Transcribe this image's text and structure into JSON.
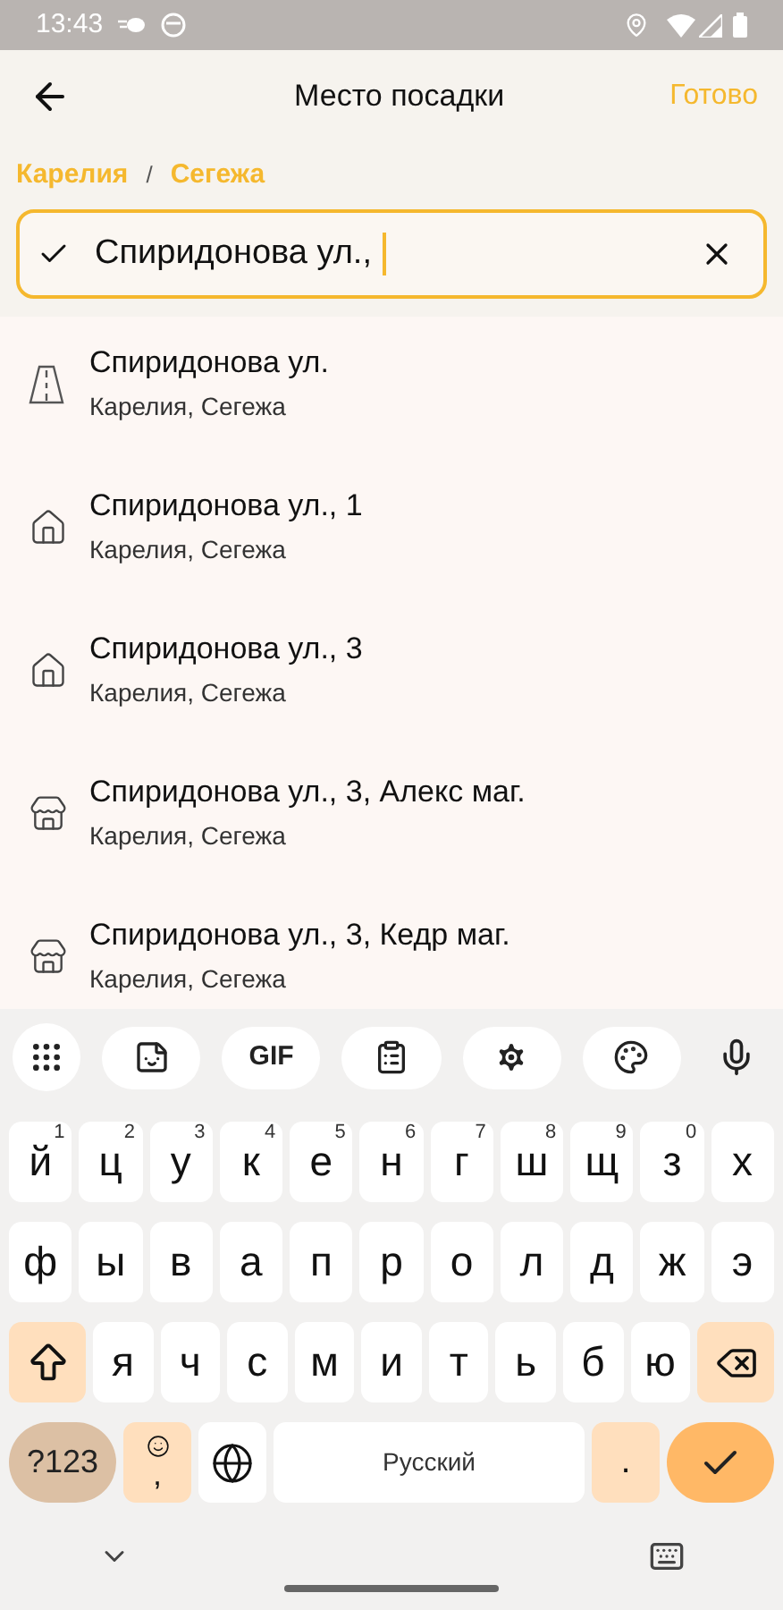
{
  "status_bar": {
    "time": "13:43"
  },
  "header": {
    "title": "Место посадки",
    "action": "Готово"
  },
  "breadcrumb": [
    {
      "label": "Карелия"
    },
    {
      "label": "Сегежа"
    }
  ],
  "breadcrumb_separator": "/",
  "search": {
    "value": "Спиридонова ул.,"
  },
  "results": [
    {
      "kind": "street",
      "title": "Спиридонова ул.",
      "subtitle": "Карелия, Сегежа"
    },
    {
      "kind": "house",
      "title": "Спиридонова ул., 1",
      "subtitle": "Карелия, Сегежа"
    },
    {
      "kind": "house",
      "title": "Спиридонова ул., 3",
      "subtitle": "Карелия, Сегежа"
    },
    {
      "kind": "shop",
      "title": "Спиридонова ул., 3, Алекс маг.",
      "subtitle": "Карелия, Сегежа"
    },
    {
      "kind": "shop",
      "title": "Спиридонова ул., 3, Кедр маг.",
      "subtitle": "Карелия, Сегежа"
    }
  ],
  "keyboard": {
    "toolbar": [
      {
        "kind": "apps"
      },
      {
        "kind": "sticker"
      },
      {
        "kind": "gif",
        "label": "GIF"
      },
      {
        "kind": "clipboard"
      },
      {
        "kind": "settings"
      },
      {
        "kind": "palette"
      },
      {
        "kind": "mic"
      }
    ],
    "rows": [
      {
        "keys": [
          {
            "kind": "char",
            "label": "й",
            "hint": "1"
          },
          {
            "kind": "char",
            "label": "ц",
            "hint": "2"
          },
          {
            "kind": "char",
            "label": "у",
            "hint": "3"
          },
          {
            "kind": "char",
            "label": "к",
            "hint": "4"
          },
          {
            "kind": "char",
            "label": "е",
            "hint": "5"
          },
          {
            "kind": "char",
            "label": "н",
            "hint": "6"
          },
          {
            "kind": "char",
            "label": "г",
            "hint": "7"
          },
          {
            "kind": "char",
            "label": "ш",
            "hint": "8"
          },
          {
            "kind": "char",
            "label": "щ",
            "hint": "9"
          },
          {
            "kind": "char",
            "label": "з",
            "hint": "0"
          },
          {
            "kind": "char",
            "label": "х"
          }
        ]
      },
      {
        "keys": [
          {
            "kind": "char",
            "label": "ф"
          },
          {
            "kind": "char",
            "label": "ы"
          },
          {
            "kind": "char",
            "label": "в"
          },
          {
            "kind": "char",
            "label": "а"
          },
          {
            "kind": "char",
            "label": "п"
          },
          {
            "kind": "char",
            "label": "р"
          },
          {
            "kind": "char",
            "label": "о"
          },
          {
            "kind": "char",
            "label": "л"
          },
          {
            "kind": "char",
            "label": "д"
          },
          {
            "kind": "char",
            "label": "ж"
          },
          {
            "kind": "char",
            "label": "э"
          }
        ]
      },
      {
        "keys": [
          {
            "kind": "shift"
          },
          {
            "kind": "char",
            "label": "я"
          },
          {
            "kind": "char",
            "label": "ч"
          },
          {
            "kind": "char",
            "label": "с"
          },
          {
            "kind": "char",
            "label": "м"
          },
          {
            "kind": "char",
            "label": "и"
          },
          {
            "kind": "char",
            "label": "т"
          },
          {
            "kind": "char",
            "label": "ь"
          },
          {
            "kind": "char",
            "label": "б"
          },
          {
            "kind": "char",
            "label": "ю"
          },
          {
            "kind": "backspace"
          }
        ]
      },
      {
        "keys": [
          {
            "kind": "symbols",
            "label": "?123"
          },
          {
            "kind": "emoji_comma",
            "label": ","
          },
          {
            "kind": "globe"
          },
          {
            "kind": "space",
            "label": "Русский"
          },
          {
            "kind": "punct",
            "label": "."
          },
          {
            "kind": "enter"
          }
        ]
      }
    ]
  }
}
